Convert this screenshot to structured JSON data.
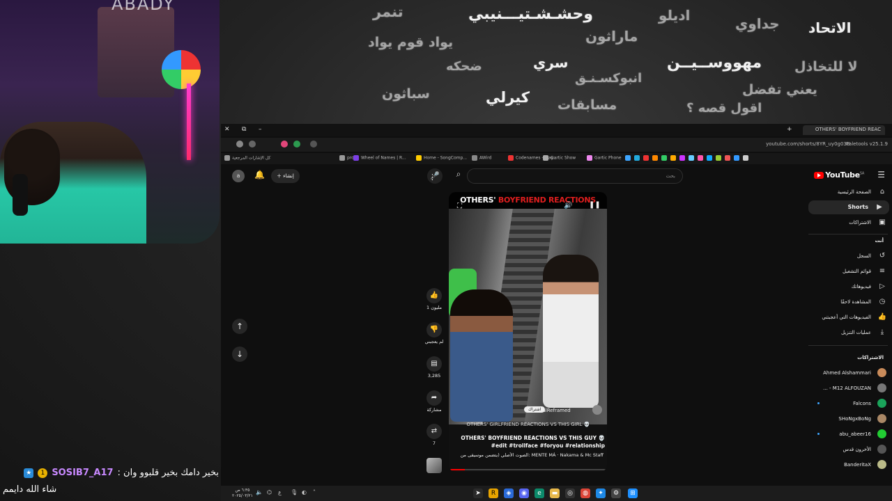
{
  "chalkboard": {
    "words": [
      {
        "text": "الاتحاد",
        "bright": true
      },
      {
        "text": "جداوي",
        "bright": false
      },
      {
        "text": "اديلو",
        "bright": false
      },
      {
        "text": "وحشـشـتيـــنيبي",
        "bright": true
      },
      {
        "text": "تنمر",
        "bright": false
      },
      {
        "text": "ماراثون",
        "bright": false
      },
      {
        "text": "يواد قوم يواد",
        "bright": false
      },
      {
        "text": "لا للتخاذل",
        "bright": false
      },
      {
        "text": "مهووســيــن",
        "bright": true
      },
      {
        "text": "سري",
        "bright": true
      },
      {
        "text": "ضحكه",
        "bright": false
      },
      {
        "text": "يعني تفضل",
        "bright": false
      },
      {
        "text": "انبوكسـنـق",
        "bright": false
      },
      {
        "text": "اقول قصه ؟",
        "bright": false
      },
      {
        "text": "مسابقات",
        "bright": false
      },
      {
        "text": "كيرلي",
        "bright": true
      },
      {
        "text": "سباثون",
        "bright": false
      }
    ]
  },
  "webcam": {
    "brand": "ABADY"
  },
  "chat": {
    "user": "SOSIB7_A17",
    "message": "بخير دامك بخير قلبوو وان :",
    "line2": "شاء الله دايمم"
  },
  "browser": {
    "tab_title": "OTHERS' BOYFRIEND REAC",
    "url": "youtube.com/shorts/8YR_uy0g03U",
    "extension": "Paletools v25.1.9",
    "bookmarks": [
      {
        "label": "كل الإشارات المرجعية",
        "color": "#999"
      },
      {
        "label": "prod",
        "color": "#999"
      },
      {
        "label": "Wheel of Names | R...",
        "color": "#7b3fe4"
      },
      {
        "label": "Home - SongComp...",
        "color": "#ffcc00"
      },
      {
        "label": "AWird",
        "color": "#888"
      },
      {
        "label": "Codenames - Play...",
        "color": "#e33"
      },
      {
        "label": "Gartic Show",
        "color": "#aaa"
      },
      {
        "label": "Gartic Phone",
        "color": "#e8e"
      }
    ]
  },
  "youtube": {
    "logo": "YouTube",
    "region": "SA",
    "search_placeholder": "بحث",
    "search_value": "",
    "create_label": "إنشاء",
    "avatar_letter": "a",
    "sidebar": {
      "main": [
        {
          "label": "الصفحة الرئيسية",
          "icon": "home-icon",
          "glyph": "⌂",
          "active": false
        },
        {
          "label": "Shorts",
          "icon": "shorts-icon",
          "glyph": "▶",
          "active": true
        },
        {
          "label": "الاشتراكات",
          "icon": "subscriptions-icon",
          "glyph": "▣",
          "active": false
        }
      ],
      "you_header": "أنت",
      "you": [
        {
          "label": "السجل",
          "icon": "history-icon",
          "glyph": "↺"
        },
        {
          "label": "قوائم التشغيل",
          "icon": "playlists-icon",
          "glyph": "≡"
        },
        {
          "label": "فيديوهاتك",
          "icon": "your-videos-icon",
          "glyph": "▷"
        },
        {
          "label": "المشاهدة لاحقًا",
          "icon": "watch-later-icon",
          "glyph": "◷"
        },
        {
          "label": "الفيديوهات التي أعجبتني",
          "icon": "liked-icon",
          "glyph": "👍"
        },
        {
          "label": "عمليات التنزيل",
          "icon": "download-icon",
          "glyph": "⤓"
        }
      ],
      "subs_header": "الاشتراكات",
      "subscriptions": [
        {
          "label": "Ahmed Alshammari",
          "color": "#c98b5a",
          "live": false
        },
        {
          "label": "M12 ALFOUZAN - ...",
          "color": "#777",
          "live": false
        },
        {
          "label": "Falcons",
          "color": "#1aa35a",
          "live": true
        },
        {
          "label": "SHoNgxBoNg",
          "color": "#a86",
          "live": false
        },
        {
          "label": "abu_abeer16",
          "color": "#2c3",
          "live": true
        },
        {
          "label": "الأخرون قدس",
          "color": "#555",
          "live": false
        },
        {
          "label": "BanderitaX",
          "color": "#bb8",
          "live": false
        }
      ]
    },
    "short": {
      "title_white": "OTHERS' ",
      "title_red": "BOYFRIEND REACTIONS",
      "channel": "@ViralReframed",
      "subscribe": "اشتراك",
      "caption_small": "OTHERS' GIRLFRIEND REACTIONS VS THIS GIRL 💀",
      "caption_main": "OTHERS' BOYFRIEND REACTIONS VS THIS GUY 💀 #edit #trollface #foryou #relationship",
      "music": "الصوت الأصلي (يتضمن موسيقى من: MENTE MÁ · Nakama & Mc Staff",
      "progress": 0.1
    },
    "actions": [
      {
        "icon": "like-icon",
        "glyph": "👍",
        "count": "1 مليون"
      },
      {
        "icon": "dislike-icon",
        "glyph": "👎",
        "count": "لم يعجبني"
      },
      {
        "icon": "comments-icon",
        "glyph": "▤",
        "count": "3,285"
      },
      {
        "icon": "share-icon",
        "glyph": "➦",
        "count": "مشاركة"
      },
      {
        "icon": "remix-icon",
        "glyph": "⇄",
        "count": "7"
      }
    ]
  },
  "taskbar": {
    "time": "٦:٣٥ ص",
    "date": "٢٠٢٥/٠٣/٢١",
    "lang": "ع"
  }
}
